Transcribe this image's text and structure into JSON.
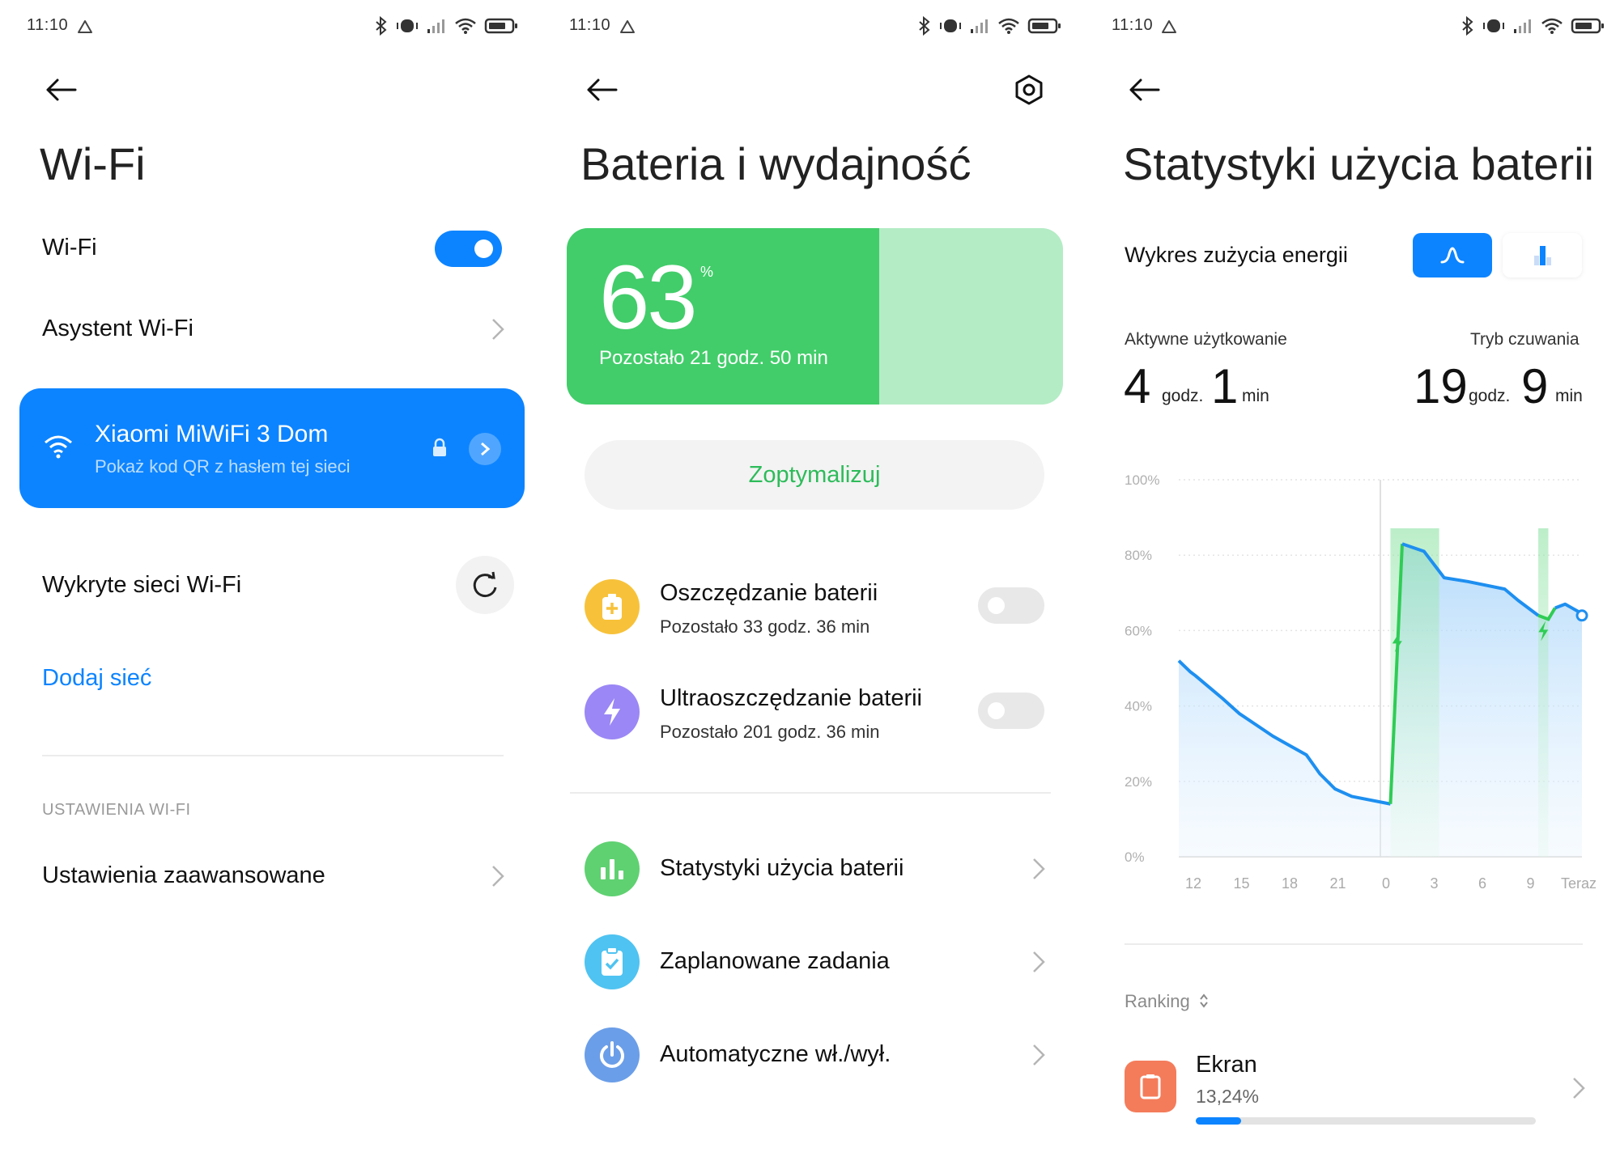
{
  "colors": {
    "accent": "#0d84ff",
    "battery_green": "#42cd6a",
    "battery_light": "#b4ecc5",
    "chart_line": "#1e8ff0",
    "charge_line": "#2fcc55"
  },
  "screen1": {
    "status_time": "11:10",
    "title": "Wi-Fi",
    "wifi_toggle": {
      "label": "Wi-Fi",
      "state": "on"
    },
    "assistant_label": "Asystent Wi-Fi",
    "connected_network": {
      "name": "Xiaomi MiWiFi 3 Dom",
      "subtitle": "Pokaż kod QR z hasłem tej sieci",
      "icons": [
        "wifi-icon",
        "lock-icon",
        "chevron-right-icon"
      ]
    },
    "detected_label": "Wykryte sieci Wi-Fi",
    "add_network": "Dodaj sieć",
    "section_header": "USTAWIENIA WI-FI",
    "advanced_label": "Ustawienia zaawansowane"
  },
  "screen2": {
    "status_time": "11:10",
    "title": "Bateria i wydajność",
    "battery": {
      "percent": "63",
      "unit": "%",
      "level": 0.63,
      "remaining": "Pozostało 21 godz. 50 min"
    },
    "optimize_button": "Zoptymalizuj",
    "modes": [
      {
        "title": "Oszczędzanie baterii",
        "subtitle": "Pozostało 33 godz. 36 min",
        "icon": "battery-plus-icon",
        "color": "#f7c23a",
        "state": "off"
      },
      {
        "title": "Ultraoszczędzanie baterii",
        "subtitle": "Pozostało 201 godz. 36 min",
        "icon": "bolt-icon",
        "color": "#9b87f5",
        "state": "off"
      }
    ],
    "links": [
      {
        "title": "Statystyki użycia baterii",
        "icon": "bar-chart-icon",
        "color": "#5fd171"
      },
      {
        "title": "Zaplanowane zadania",
        "icon": "clipboard-check-icon",
        "color": "#4fc3f1"
      },
      {
        "title": "Automatyczne wł./wył.",
        "icon": "power-icon",
        "color": "#6b9ee8"
      }
    ]
  },
  "screen3": {
    "status_time": "11:10",
    "title": "Statystyki użycia baterii",
    "chart_label": "Wykres zużycia energii",
    "active_usage": {
      "label": "Aktywne użytkowanie",
      "hours": "4",
      "hours_unit": "godz.",
      "minutes": "1",
      "minutes_unit": "min"
    },
    "standby": {
      "label": "Tryb czuwania",
      "hours": "19",
      "hours_unit": "godz.",
      "minutes": "9",
      "minutes_unit": "min"
    },
    "ranking_label": "Ranking",
    "top_item": {
      "name": "Ekran",
      "percent": "13,24%",
      "share": 0.1324
    }
  },
  "chart_data": {
    "type": "area",
    "ylim": [
      0,
      100
    ],
    "y_tick_labels": [
      "100%",
      "80%",
      "60%",
      "40%",
      "20%",
      "0%"
    ],
    "x_tick_labels": [
      "12",
      "15",
      "18",
      "21",
      "0",
      "3",
      "6",
      "9",
      "Teraz"
    ],
    "grid": true,
    "x": [
      12,
      12.7,
      13,
      13.8,
      14.6,
      15.6,
      16.6,
      17.6,
      18.4,
      19.6,
      20.4,
      21.3,
      22.3,
      24.6,
      25.3,
      26.6,
      27.8,
      29.2,
      31.4,
      32.2,
      33.4,
      34.0,
      34.4,
      35.0,
      35.4,
      35.8,
      36.0
    ],
    "series": [
      {
        "values": [
          52,
          49,
          48,
          45,
          42,
          38,
          35,
          32,
          30,
          27,
          22,
          18,
          16,
          14,
          83,
          81,
          74,
          73,
          71,
          68,
          64,
          63,
          66,
          67,
          66,
          65,
          64
        ]
      }
    ],
    "charging_periods": [
      [
        24.6,
        27.5
      ],
      [
        33.4,
        34.0
      ]
    ]
  }
}
